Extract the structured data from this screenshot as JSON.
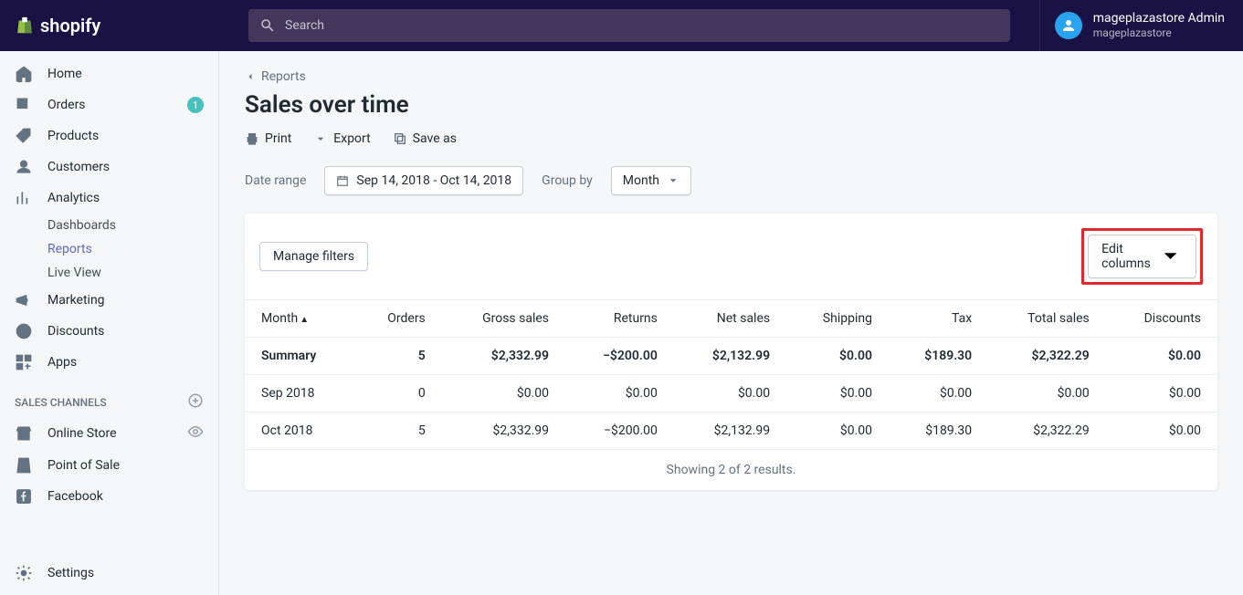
{
  "brand": "shopify",
  "search": {
    "placeholder": "Search"
  },
  "user": {
    "name": "mageplazastore Admin",
    "store": "mageplazastore"
  },
  "sidebar": {
    "home": "Home",
    "orders": "Orders",
    "orders_badge": "1",
    "products": "Products",
    "customers": "Customers",
    "analytics": "Analytics",
    "dashboards": "Dashboards",
    "reports": "Reports",
    "liveview": "Live View",
    "marketing": "Marketing",
    "discounts": "Discounts",
    "apps": "Apps",
    "channels_label": "SALES CHANNELS",
    "online_store": "Online Store",
    "pos": "Point of Sale",
    "facebook": "Facebook",
    "settings": "Settings"
  },
  "breadcrumb": "Reports",
  "page_title": "Sales over time",
  "actions": {
    "print": "Print",
    "export": "Export",
    "saveas": "Save as"
  },
  "filters": {
    "date_label": "Date range",
    "date_value": "Sep 14, 2018 - Oct 14, 2018",
    "group_label": "Group by",
    "group_value": "Month"
  },
  "card": {
    "manage_filters": "Manage filters",
    "edit_columns": "Edit columns"
  },
  "table": {
    "headers": {
      "month": "Month",
      "orders": "Orders",
      "gross": "Gross sales",
      "returns": "Returns",
      "net": "Net sales",
      "shipping": "Shipping",
      "tax": "Tax",
      "total": "Total sales",
      "discounts": "Discounts"
    },
    "rows": [
      {
        "month": "Summary",
        "orders": "5",
        "gross": "$2,332.99",
        "returns": "−$200.00",
        "net": "$2,132.99",
        "shipping": "$0.00",
        "tax": "$189.30",
        "total": "$2,322.29",
        "discounts": "$0.00"
      },
      {
        "month": "Sep 2018",
        "orders": "0",
        "gross": "$0.00",
        "returns": "$0.00",
        "net": "$0.00",
        "shipping": "$0.00",
        "tax": "$0.00",
        "total": "$0.00",
        "discounts": "$0.00"
      },
      {
        "month": "Oct 2018",
        "orders": "5",
        "gross": "$2,332.99",
        "returns": "−$200.00",
        "net": "$2,132.99",
        "shipping": "$0.00",
        "tax": "$189.30",
        "total": "$2,322.29",
        "discounts": "$0.00"
      }
    ]
  },
  "results_note": "Showing 2 of 2 results."
}
